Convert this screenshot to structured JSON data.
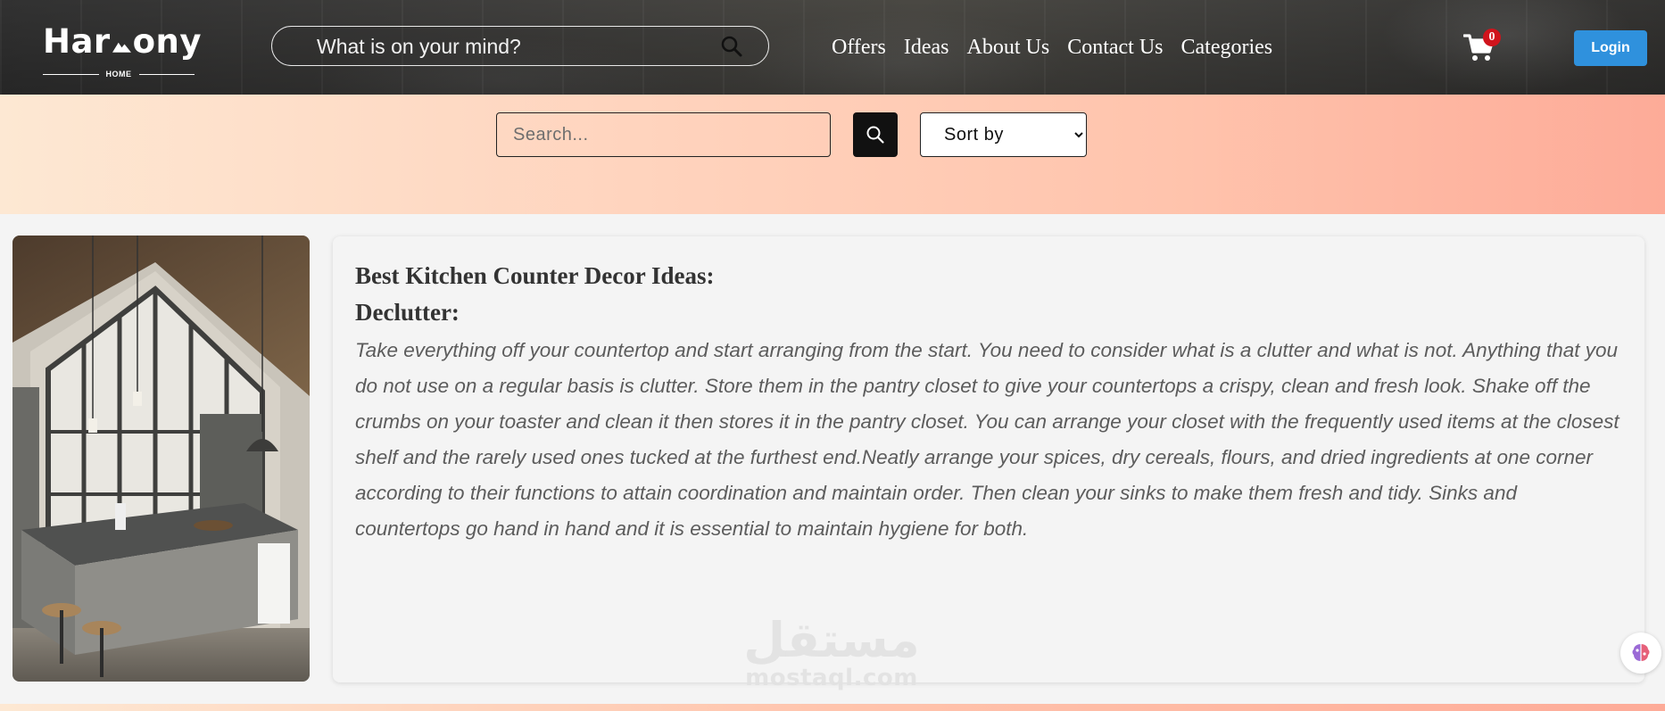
{
  "header": {
    "logo": {
      "text_left": "Har",
      "text_right": "ony",
      "subtitle": "HOME"
    },
    "search": {
      "placeholder": "What is on your mind?"
    },
    "nav": [
      {
        "label": "Offers"
      },
      {
        "label": "Ideas"
      },
      {
        "label": "About Us"
      },
      {
        "label": "Contact Us"
      },
      {
        "label": "Categories"
      }
    ],
    "cart": {
      "count": "0",
      "icon": "shopping-cart-icon"
    },
    "login_label": "Login"
  },
  "filter": {
    "search_placeholder": "Search...",
    "search_icon": "search-icon",
    "sort_options": [
      "Sort by"
    ]
  },
  "article": {
    "title": "Best Kitchen Counter Decor Ideas:",
    "subtitle": "Declutter:",
    "body": "Take everything off your countertop and start arranging from the start. You need to consider what is a clutter and what is not. Anything that you do not use on a regular basis is clutter. Store them in the pantry closet to give your countertops a crispy, clean and fresh look. Shake off the crumbs on your toaster and clean it then stores it in the pantry closet. You can arrange your closet with the frequently used items at the closest shelf and the rarely used ones tucked at the furthest end.Neatly arrange your spices, dry cereals, flours, and dried ingredients at one corner according to their functions to attain coordination and maintain order. Then clean your sinks to make them fresh and tidy. Sinks and countertops go hand in hand and it is essential to maintain hygiene for both."
  },
  "watermark": {
    "arabic": "مستقل",
    "latin": "mostaql.com"
  },
  "colors": {
    "login_button": "#2f91dd",
    "cart_badge": "#d0141c",
    "filter_band_start": "#fde8d3",
    "filter_band_end": "#fdab98"
  }
}
